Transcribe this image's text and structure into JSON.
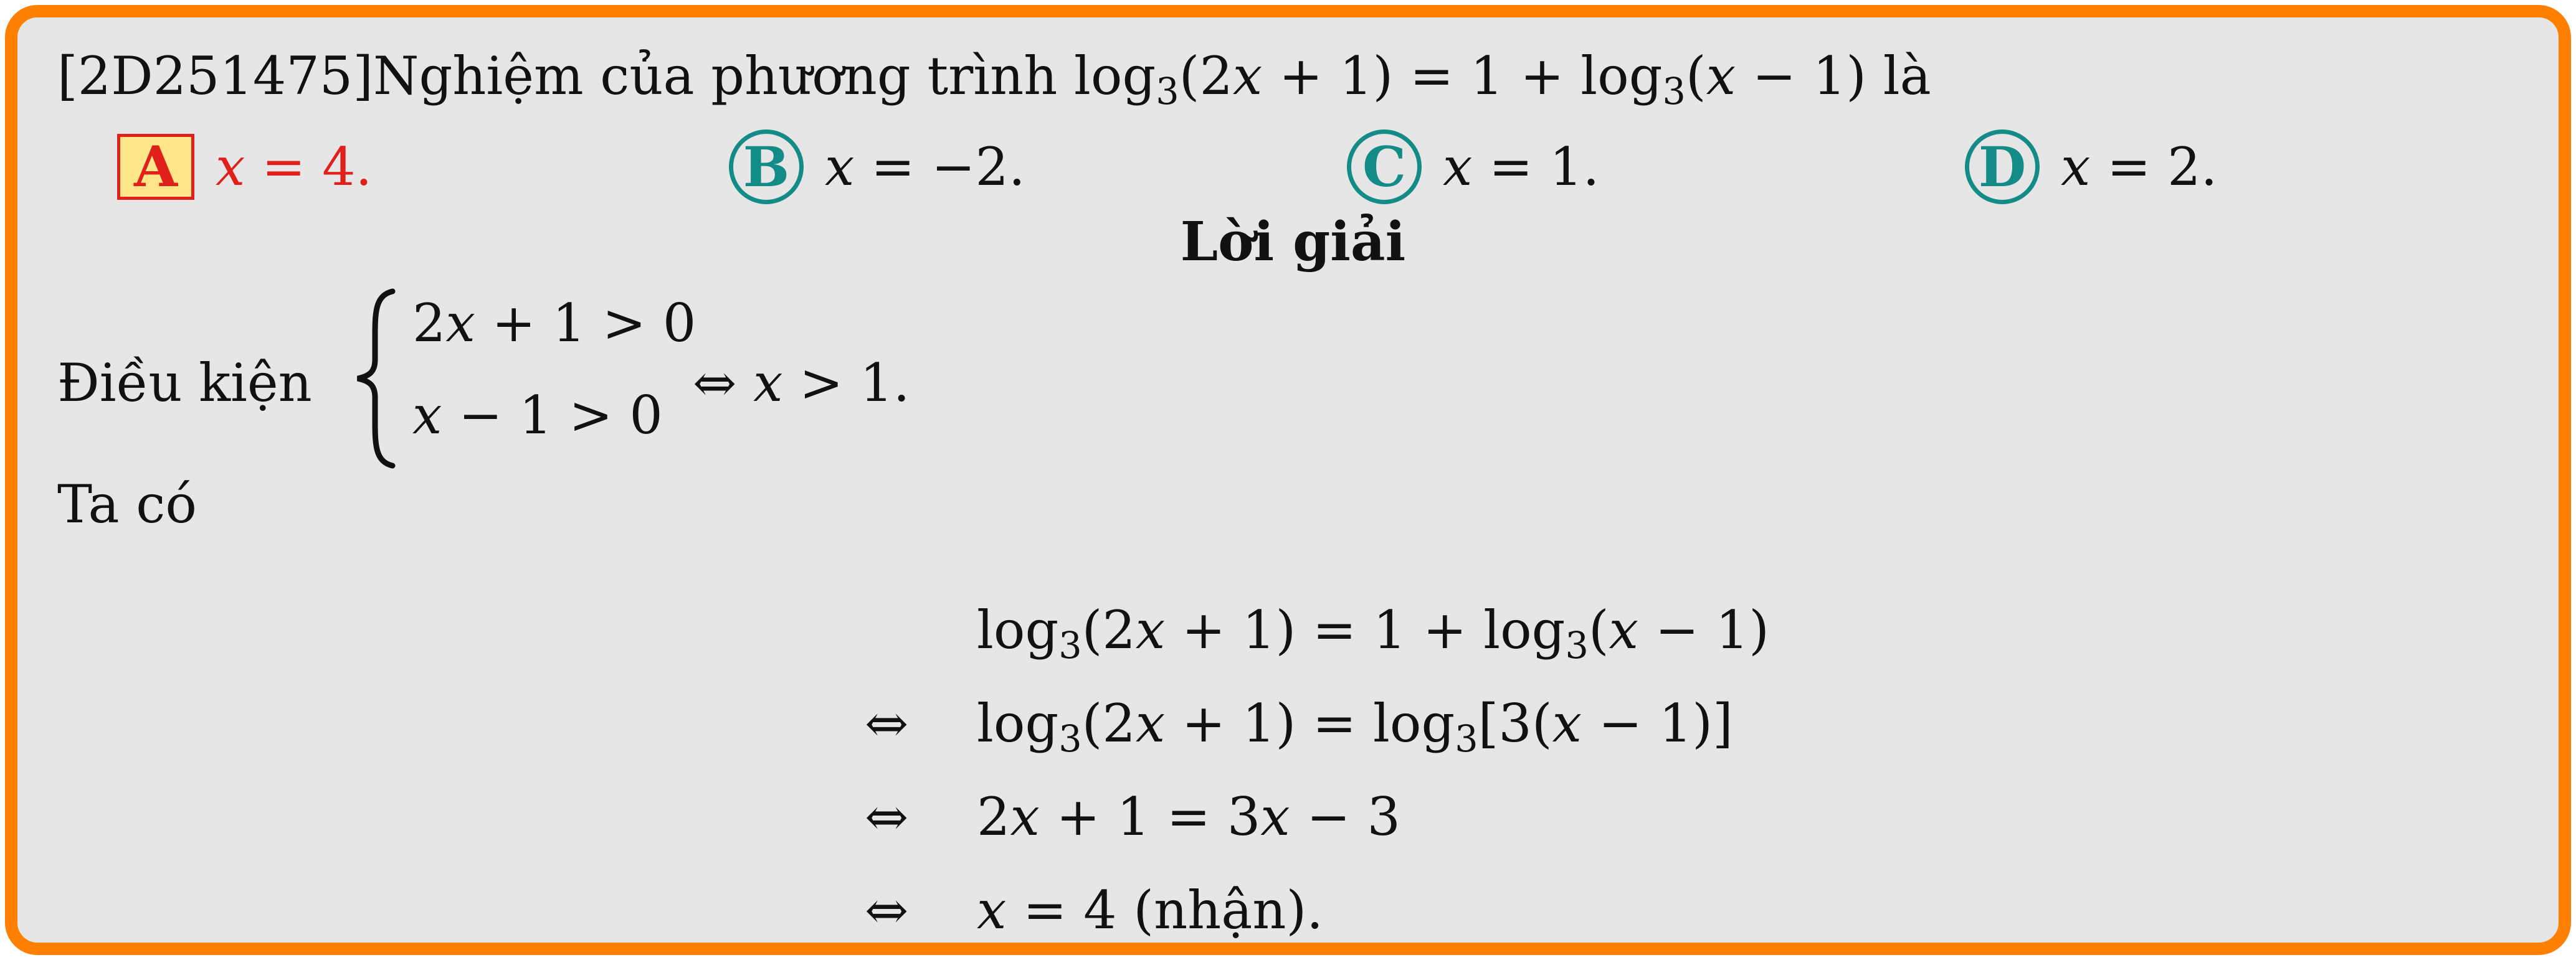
{
  "problem": {
    "code": "[2D251475]",
    "text_lead": "Nghiệm của phương trình ",
    "equation": {
      "a": "log",
      "b": "3",
      "c": "(2",
      "d": "x",
      "e": " + 1) = 1 + log",
      "f": "3",
      "g": "(",
      "h": "x",
      "i": " − 1)"
    },
    "text_tail": " là"
  },
  "choices": [
    {
      "letter": "A",
      "var": "x",
      "rest": " = 4.",
      "correct": true
    },
    {
      "letter": "B",
      "var": "x",
      "rest": " = −2.",
      "correct": false
    },
    {
      "letter": "C",
      "var": "x",
      "rest": " = 1.",
      "correct": false
    },
    {
      "letter": "D",
      "var": "x",
      "rest": " = 2.",
      "correct": false
    }
  ],
  "solution": {
    "heading": "Lời giải",
    "condition_label": "Điều kiện",
    "system": [
      {
        "a": "2",
        "b": "x",
        "c": " + 1 > 0"
      },
      {
        "a": "",
        "b": "x",
        "c": " − 1 > 0"
      }
    ],
    "condition_result": {
      "sym": "⇔ ",
      "var": "x",
      "rest": " > 1."
    },
    "intro": "Ta có",
    "steps": [
      {
        "sym": "",
        "parts": [
          "log",
          "3",
          "(2",
          "x",
          " + 1) = 1 + log",
          "3",
          "(",
          "x",
          " − 1)"
        ]
      },
      {
        "sym": "⇔",
        "parts": [
          "log",
          "3",
          "(2",
          "x",
          " + 1) = log",
          "3",
          "[3(",
          "x",
          " − 1)]"
        ]
      },
      {
        "sym": "⇔",
        "parts": [
          "2",
          "x",
          " + 1 = 3",
          "x",
          " − 3"
        ]
      },
      {
        "sym": "⇔",
        "parts": [
          "x",
          " = 4 (nhận)."
        ]
      }
    ]
  },
  "colors": {
    "border": "#ff8000",
    "background": "#e6e6e6",
    "correct": "#e0201a",
    "choice_circle": "#138b86",
    "answer_highlight": "#ffe68a"
  }
}
